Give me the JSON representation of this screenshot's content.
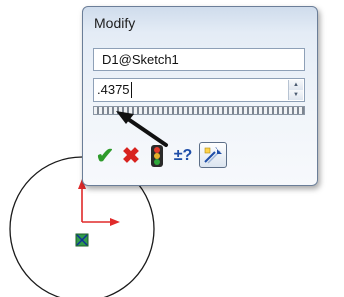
{
  "dialog": {
    "title": "Modify",
    "dimension_name": "D1@Sketch1",
    "value": ".4375"
  },
  "buttons": {
    "ok_icon": "checkmark-icon",
    "cancel_icon": "x-icon",
    "rebuild_icon": "traffic-light-icon",
    "help_label": "±?",
    "mark_icon": "mark-dimension-icon"
  },
  "colors": {
    "ok": "#2e9b2b",
    "cancel": "#d8231f",
    "axis_y": "#e02a2a",
    "origin_marker": "#2f9a4a"
  }
}
